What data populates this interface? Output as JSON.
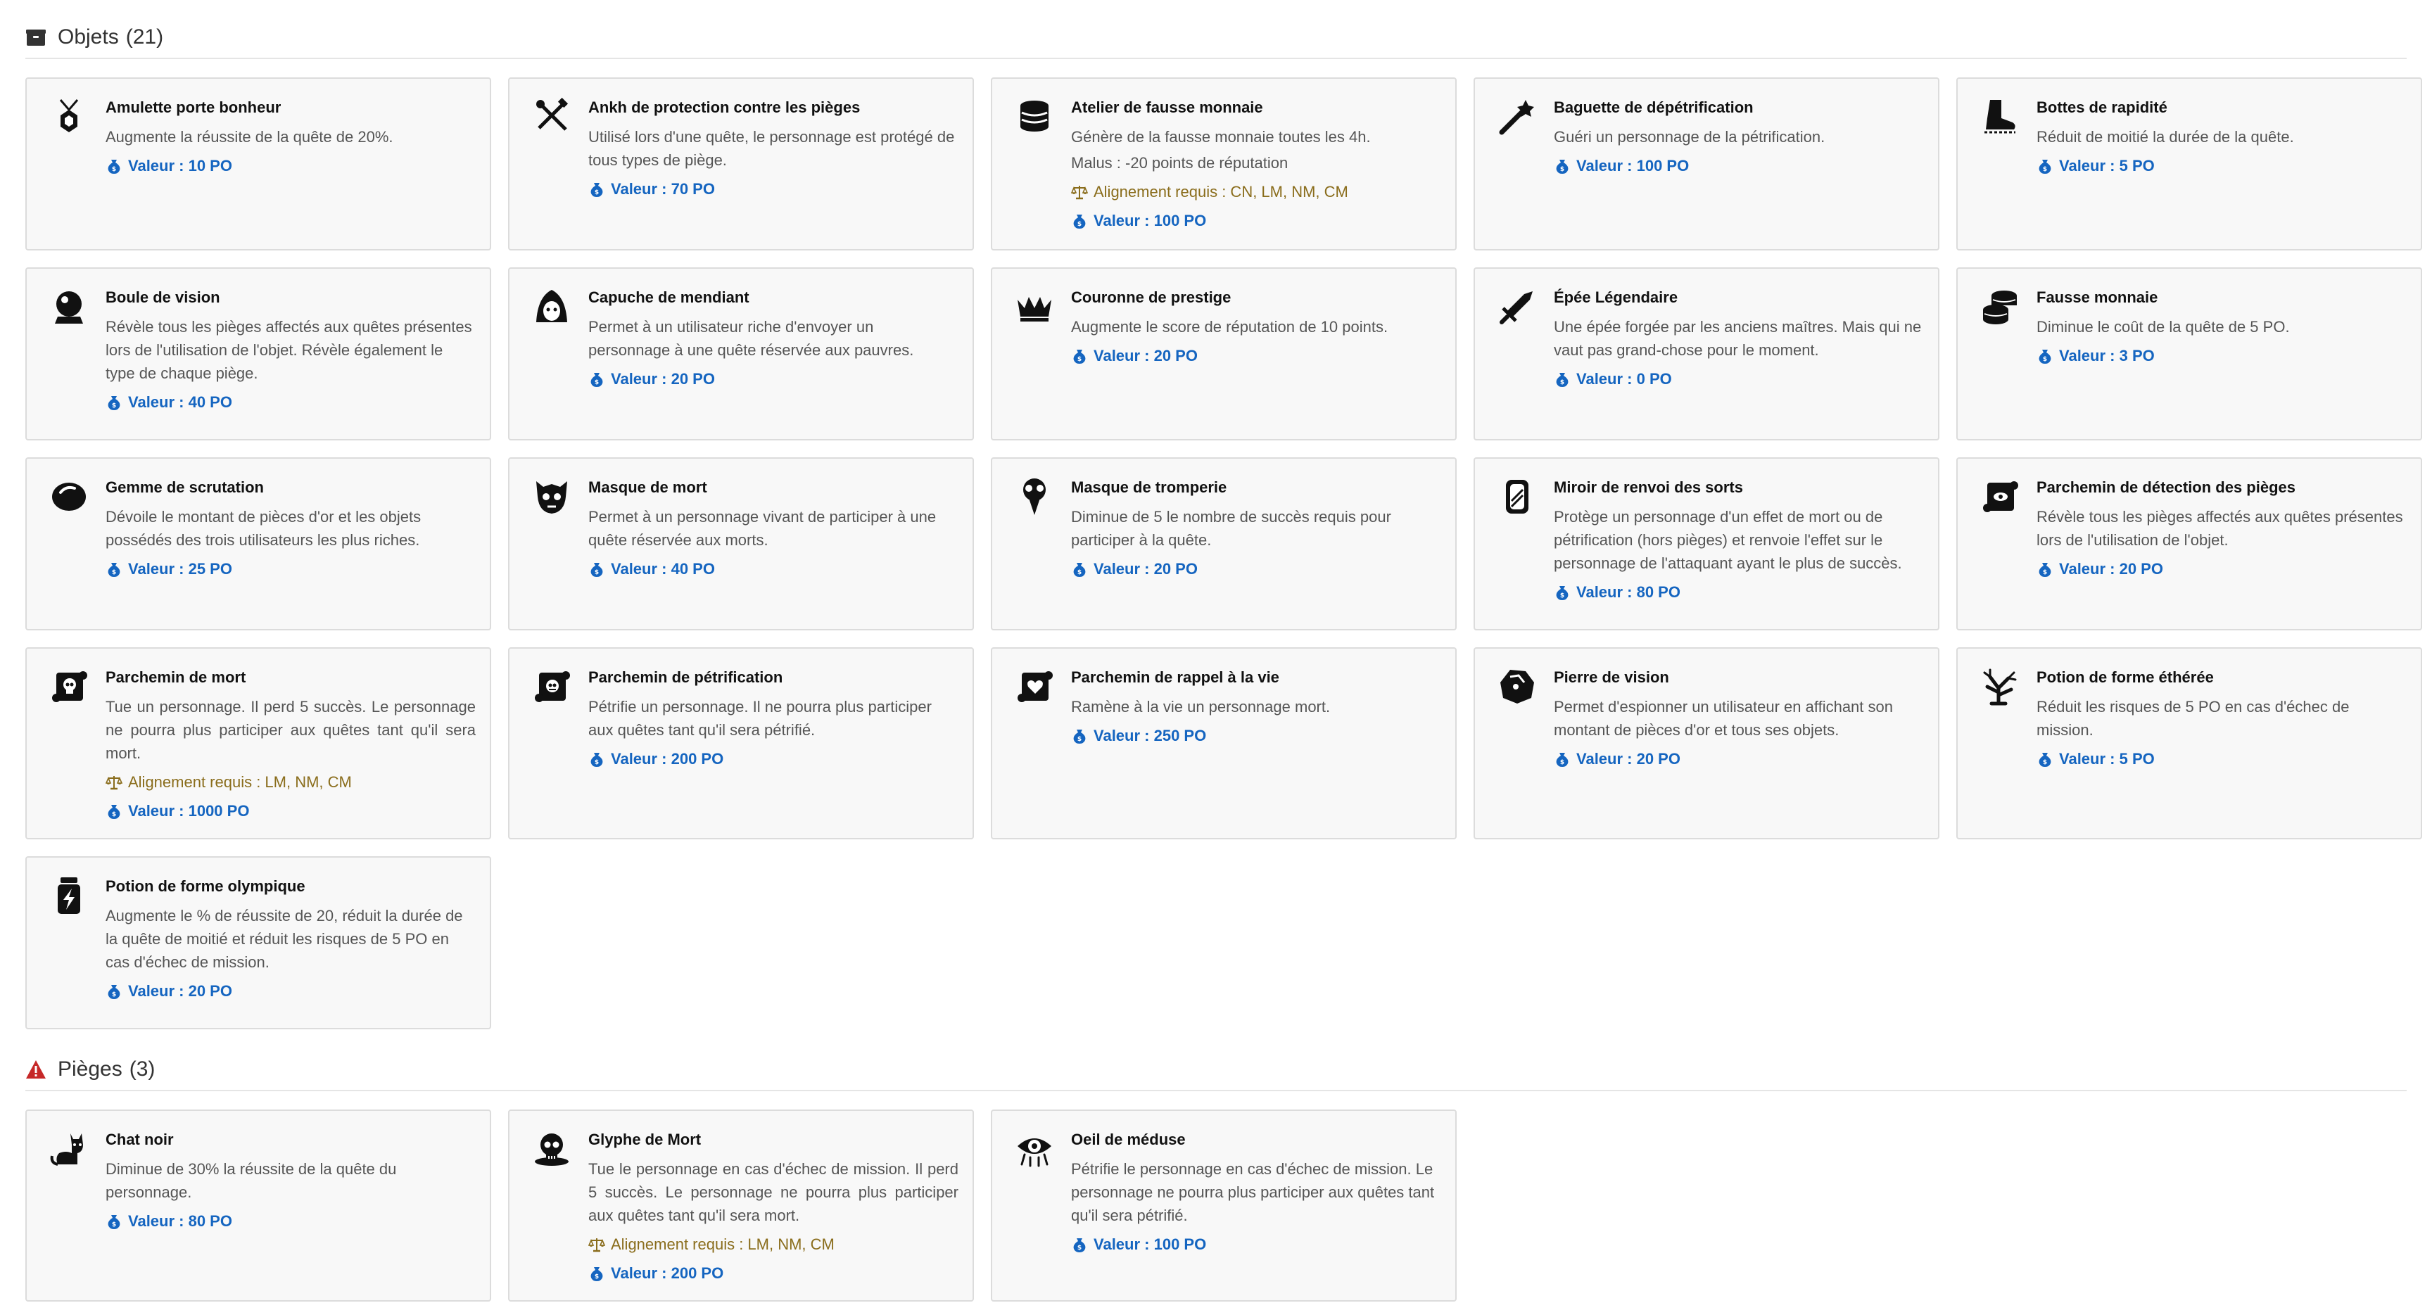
{
  "objects_section": {
    "title": "Objets",
    "count": "(21)",
    "items": [
      {
        "title": "Amulette porte bonheur",
        "desc": "Augmente la réussite de la quête de 20%.",
        "value": "Valeur : 10 PO",
        "icon": "amulet-icon"
      },
      {
        "title": "Ankh de protection contre les pièges",
        "desc": "Utilisé lors d'une quête, le personnage est protégé de tous types de piège.",
        "value": "Valeur : 70 PO",
        "icon": "crossed-tools-icon"
      },
      {
        "title": "Atelier de fausse monnaie",
        "desc": "Génère de la fausse monnaie toutes les 4h.",
        "malus": "Malus : -20 points de réputation",
        "alignment": "Alignement requis : CN, LM, NM, CM",
        "value": "Valeur : 100 PO",
        "icon": "coin-press-icon"
      },
      {
        "title": "Baguette de dépétrification",
        "desc": "Guéri un personnage de la pétrification.",
        "value": "Valeur : 100 PO",
        "icon": "wand-icon"
      },
      {
        "title": "Bottes de rapidité",
        "desc": "Réduit de moitié la durée de la quête.",
        "value": "Valeur : 5 PO",
        "icon": "boot-icon"
      },
      {
        "title": "Boule de vision",
        "desc": "Révèle tous les pièges affectés aux quêtes présentes lors de l'utilisation de l'objet. Révèle également le type de chaque piège.",
        "value": "Valeur : 40 PO",
        "icon": "crystal-ball-icon"
      },
      {
        "title": "Capuche de mendiant",
        "desc": "Permet à un utilisateur riche d'envoyer un personnage à une quête réservée aux pauvres.",
        "value": "Valeur : 20 PO",
        "icon": "hood-icon"
      },
      {
        "title": "Couronne de prestige",
        "desc": "Augmente le score de réputation de 10 points.",
        "value": "Valeur : 20 PO",
        "icon": "crown-icon"
      },
      {
        "title": "Épée Légendaire",
        "desc": "Une épée forgée par les anciens maîtres. Mais qui ne vaut pas grand-chose pour le moment.",
        "value": "Valeur : 0 PO",
        "icon": "sword-icon"
      },
      {
        "title": "Fausse monnaie",
        "desc": "Diminue le coût de la quête de 5 PO.",
        "value": "Valeur : 3 PO",
        "icon": "coin-stack-icon"
      },
      {
        "title": "Gemme de scrutation",
        "desc": "Dévoile le montant de pièces d'or et les objets possédés des trois utilisateurs les plus riches.",
        "value": "Valeur : 25 PO",
        "icon": "gem-icon"
      },
      {
        "title": "Masque de mort",
        "desc": "Permet à un personnage vivant de participer à une quête réservée aux morts.",
        "value": "Valeur : 40 PO",
        "icon": "death-mask-icon"
      },
      {
        "title": "Masque de tromperie",
        "desc": "Diminue de 5 le nombre de succès requis pour participer à la quête.",
        "value": "Valeur : 20 PO",
        "icon": "plague-mask-icon"
      },
      {
        "title": "Miroir de renvoi des sorts",
        "desc": "Protège un personnage d'un effet de mort ou de pétrification (hors pièges) et renvoie l'effet sur le personnage de l'attaquant ayant le plus de succès.",
        "value": "Valeur : 80 PO",
        "icon": "mirror-icon"
      },
      {
        "title": "Parchemin de détection des pièges",
        "desc": "Révèle tous les pièges affectés aux quêtes présentes lors de l'utilisation de l'objet.",
        "value": "Valeur : 20 PO",
        "icon": "scroll-eye-icon"
      },
      {
        "title": "Parchemin de mort",
        "desc": "Tue un personnage. Il perd 5 succès. Le personnage ne pourra plus participer aux quêtes tant qu'il sera mort.",
        "alignment": "Alignement requis : LM, NM, CM",
        "value": "Valeur : 1000 PO",
        "icon": "scroll-skull-icon"
      },
      {
        "title": "Parchemin de pétrification",
        "desc": "Pétrifie un personnage. Il ne pourra plus participer aux quêtes tant qu'il sera pétrifié.",
        "value": "Valeur : 200 PO",
        "icon": "scroll-stone-icon"
      },
      {
        "title": "Parchemin de rappel à la vie",
        "desc": "Ramène à la vie un personnage mort.",
        "value": "Valeur : 250 PO",
        "icon": "scroll-heart-icon"
      },
      {
        "title": "Pierre de vision",
        "desc": "Permet d'espionner un utilisateur en affichant son montant de pièces d'or et tous ses objets.",
        "value": "Valeur : 20 PO",
        "icon": "stone-icon"
      },
      {
        "title": "Potion de forme éthérée",
        "desc": "Réduit les risques de 5 PO en cas d'échec de mission.",
        "value": "Valeur : 5 PO",
        "icon": "tree-icon"
      },
      {
        "title": "Potion de forme olympique",
        "desc": "Augmente le % de réussite de 20, réduit la durée de la quête de moitié et réduit les risques de 5 PO en cas d'échec de mission.",
        "value": "Valeur : 20 PO",
        "icon": "potion-bolt-icon"
      }
    ]
  },
  "traps_section": {
    "title": "Pièges",
    "count": "(3)",
    "items": [
      {
        "title": "Chat noir",
        "desc": "Diminue de 30% la réussite de la quête du personnage.",
        "value": "Valeur : 80 PO",
        "icon": "cat-icon"
      },
      {
        "title": "Glyphe de Mort",
        "desc": "Tue le personnage en cas d'échec de mission. Il perd 5 succès. Le personnage ne pourra plus participer aux quêtes tant qu'il sera mort.",
        "alignment": "Alignement requis : LM, NM, CM",
        "value": "Valeur : 200 PO",
        "icon": "skull-glyph-icon"
      },
      {
        "title": "Oeil de méduse",
        "desc": "Pétrifie le personnage en cas d'échec de mission. Le personnage ne pourra plus participer aux quêtes tant qu'il sera pétrifié.",
        "value": "Valeur : 100 PO",
        "icon": "medusa-eye-icon"
      }
    ]
  },
  "colors": {
    "value": "#1565c0",
    "alignment": "#8a6d1c",
    "trap_icon": "#c62828"
  }
}
